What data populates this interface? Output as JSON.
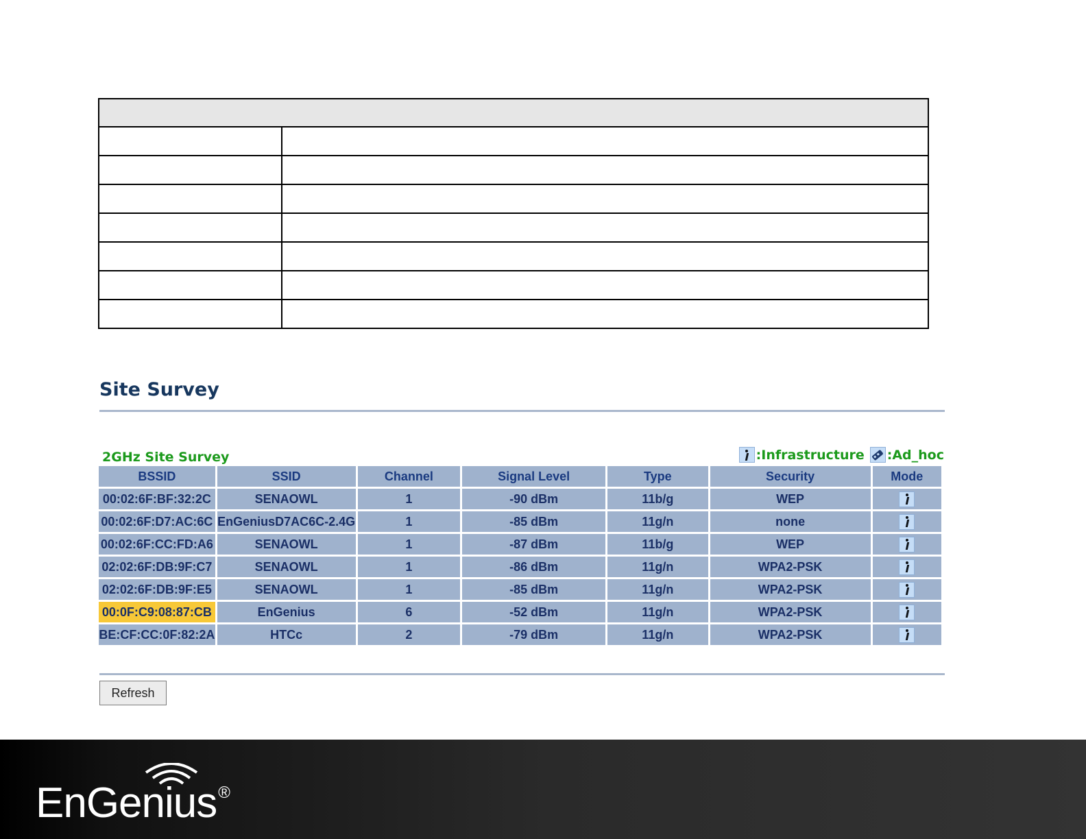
{
  "site_survey": {
    "title": "Site Survey",
    "subtitle": "2GHz Site Survey",
    "legend": {
      "infrastructure_label": ":Infrastructure",
      "adhoc_label": ":Ad_hoc"
    },
    "columns": [
      "BSSID",
      "SSID",
      "Channel",
      "Signal Level",
      "Type",
      "Security",
      "Mode"
    ],
    "rows": [
      {
        "bssid": "00:02:6F:BF:32:2C",
        "ssid": "SENAOWL",
        "channel": "1",
        "signal": "-90 dBm",
        "type": "11b/g",
        "security": "WEP",
        "mode": "infrastructure"
      },
      {
        "bssid": "00:02:6F:D7:AC:6C",
        "ssid": "EnGeniusD7AC6C-2.4G",
        "channel": "1",
        "signal": "-85 dBm",
        "type": "11g/n",
        "security": "none",
        "mode": "infrastructure"
      },
      {
        "bssid": "00:02:6F:CC:FD:A6",
        "ssid": "SENAOWL",
        "channel": "1",
        "signal": "-87 dBm",
        "type": "11b/g",
        "security": "WEP",
        "mode": "infrastructure"
      },
      {
        "bssid": "02:02:6F:DB:9F:C7",
        "ssid": "SENAOWL",
        "channel": "1",
        "signal": "-86 dBm",
        "type": "11g/n",
        "security": "WPA2-PSK",
        "mode": "infrastructure"
      },
      {
        "bssid": "02:02:6F:DB:9F:E5",
        "ssid": "SENAOWL",
        "channel": "1",
        "signal": "-85 dBm",
        "type": "11g/n",
        "security": "WPA2-PSK",
        "mode": "infrastructure"
      },
      {
        "bssid": "00:0F:C9:08:87:CB",
        "ssid": "EnGenius",
        "channel": "6",
        "signal": "-52 dBm",
        "type": "11g/n",
        "security": "WPA2-PSK",
        "mode": "infrastructure",
        "highlighted": true
      },
      {
        "bssid": "BE:CF:CC:0F:82:2A",
        "ssid": "HTCc",
        "channel": "2",
        "signal": "-79 dBm",
        "type": "11g/n",
        "security": "WPA2-PSK",
        "mode": "infrastructure"
      }
    ],
    "refresh_label": "Refresh"
  },
  "footer": {
    "logo_text": "EnGenius",
    "logo_mark": "®"
  },
  "colors": {
    "title": "#17375e",
    "subtitle": "#1c9a1c",
    "cell_bg": "#9fb2cd",
    "highlight": "#f7c838"
  },
  "icons": {
    "infrastructure": "infrastructure-mode-icon",
    "adhoc": "adhoc-mode-icon"
  }
}
